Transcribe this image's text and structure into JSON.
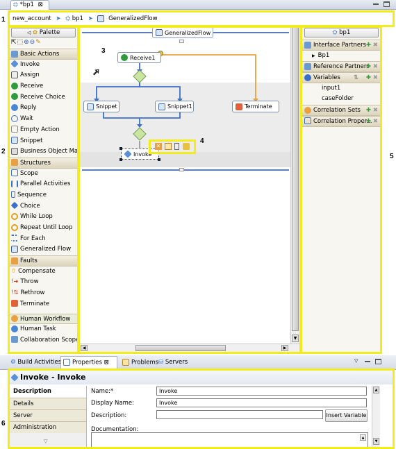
{
  "editor": {
    "tab": "*bp1",
    "close": "⊠"
  },
  "breadcrumb": [
    "new_account",
    "bp1",
    "GeneralizedFlow"
  ],
  "palette": {
    "title": "Palette",
    "basic": {
      "title": "Basic Actions",
      "items": [
        "Invoke",
        "Assign",
        "Receive",
        "Receive Choice",
        "Reply",
        "Wait",
        "Empty Action",
        "Snippet",
        "Business Object Map"
      ]
    },
    "structures": {
      "title": "Structures",
      "items": [
        "Scope",
        "Parallel Activities",
        "Sequence",
        "Choice",
        "While Loop",
        "Repeat Until Loop",
        "For Each",
        "Generalized Flow"
      ]
    },
    "faults": {
      "title": "Faults",
      "items": [
        "Compensate",
        "Throw",
        "Rethrow",
        "Terminate"
      ]
    },
    "human": {
      "title": "Human Workflow",
      "items": [
        "Human Task",
        "Collaboration Scope"
      ]
    }
  },
  "canvas": {
    "flow_title": "GeneralizedFlow",
    "receive": "Receive1",
    "snippet": "Snippet",
    "snippet1": "Snippet1",
    "terminate": "Terminate",
    "invoke": "Invoke"
  },
  "tray": {
    "title": "bp1",
    "interface": "Interface Partners",
    "bp1": "Bp1",
    "reference": "Reference Partners",
    "variables": "Variables",
    "var_items": [
      "input1",
      "caseFolder"
    ],
    "correlation_sets": "Correlation Sets",
    "correlation_props": "Correlation Proper..."
  },
  "bottom": {
    "tabs": [
      "Build Activities",
      "Properties",
      "Problems",
      "Servers"
    ],
    "header": "Invoke - Invoke",
    "side_tabs": [
      "Description",
      "Details",
      "Server",
      "Administration"
    ],
    "labels": {
      "name": "Name:*",
      "display": "Display Name:",
      "description": "Description:",
      "documentation": "Documentation:"
    },
    "values": {
      "name": "Invoke",
      "display": "Invoke",
      "description": ""
    },
    "insert_variable": "Insert Variable"
  },
  "annotations": [
    "1",
    "2",
    "3",
    "4",
    "5",
    "6"
  ],
  "colors": {
    "highlight": "#f2ec1c",
    "arrow": "#3c6fc8",
    "terminate_link": "#e8a040"
  }
}
